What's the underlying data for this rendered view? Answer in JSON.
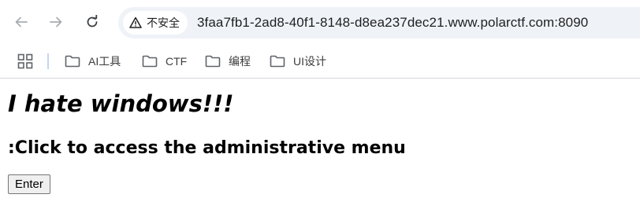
{
  "browser": {
    "security_label": "不安全",
    "url": "3faa7fb1-2ad8-40f1-8148-d8ea237dec21.www.polarctf.com:8090",
    "nav_icons": [
      "back-arrow-icon",
      "forward-arrow-icon",
      "reload-icon",
      "warning-icon"
    ]
  },
  "bookmarks": {
    "items": [
      {
        "label": "AI工具",
        "icon": "folder-icon"
      },
      {
        "label": "CTF",
        "icon": "folder-icon"
      },
      {
        "label": "编程",
        "icon": "folder-icon"
      },
      {
        "label": "UI设计",
        "icon": "folder-icon"
      }
    ]
  },
  "page": {
    "heading": "I hate windows!!!",
    "subheading": ":Click to access the administrative menu",
    "button_label": "Enter"
  }
}
